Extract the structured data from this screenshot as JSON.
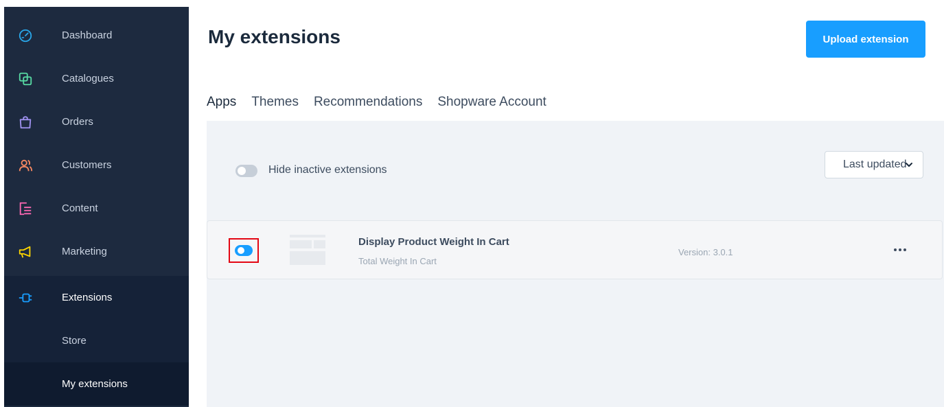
{
  "sidebar": {
    "items": [
      {
        "label": "Dashboard",
        "icon": "gauge-icon",
        "color": "#29a6e8"
      },
      {
        "label": "Catalogues",
        "icon": "catalog-icon",
        "color": "#57d9a3"
      },
      {
        "label": "Orders",
        "icon": "shopping-bag-icon",
        "color": "#a092f0"
      },
      {
        "label": "Customers",
        "icon": "users-icon",
        "color": "#f88962"
      },
      {
        "label": "Content",
        "icon": "content-icon",
        "color": "#ff68b4"
      },
      {
        "label": "Marketing",
        "icon": "megaphone-icon",
        "color": "#ffd700"
      },
      {
        "label": "Extensions",
        "icon": "plug-icon",
        "color": "#189eff"
      }
    ],
    "subitems": [
      {
        "label": "Store"
      },
      {
        "label": "My extensions"
      }
    ]
  },
  "header": {
    "title": "My extensions",
    "upload_label": "Upload extension"
  },
  "tabs": [
    {
      "label": "Apps"
    },
    {
      "label": "Themes"
    },
    {
      "label": "Recommendations"
    },
    {
      "label": "Shopware Account"
    }
  ],
  "filters": {
    "hide_inactive_label": "Hide inactive extensions",
    "hide_inactive_on": false,
    "sort_selected": "Last updated"
  },
  "extensions": [
    {
      "name": "Display Product Weight In Cart",
      "description": "Total Weight In Cart",
      "version": "Version: 3.0.1",
      "active": true
    }
  ],
  "colors": {
    "accent": "#189eff",
    "sidebar_bg": "#1d2a3f",
    "highlight": "#e30613"
  }
}
